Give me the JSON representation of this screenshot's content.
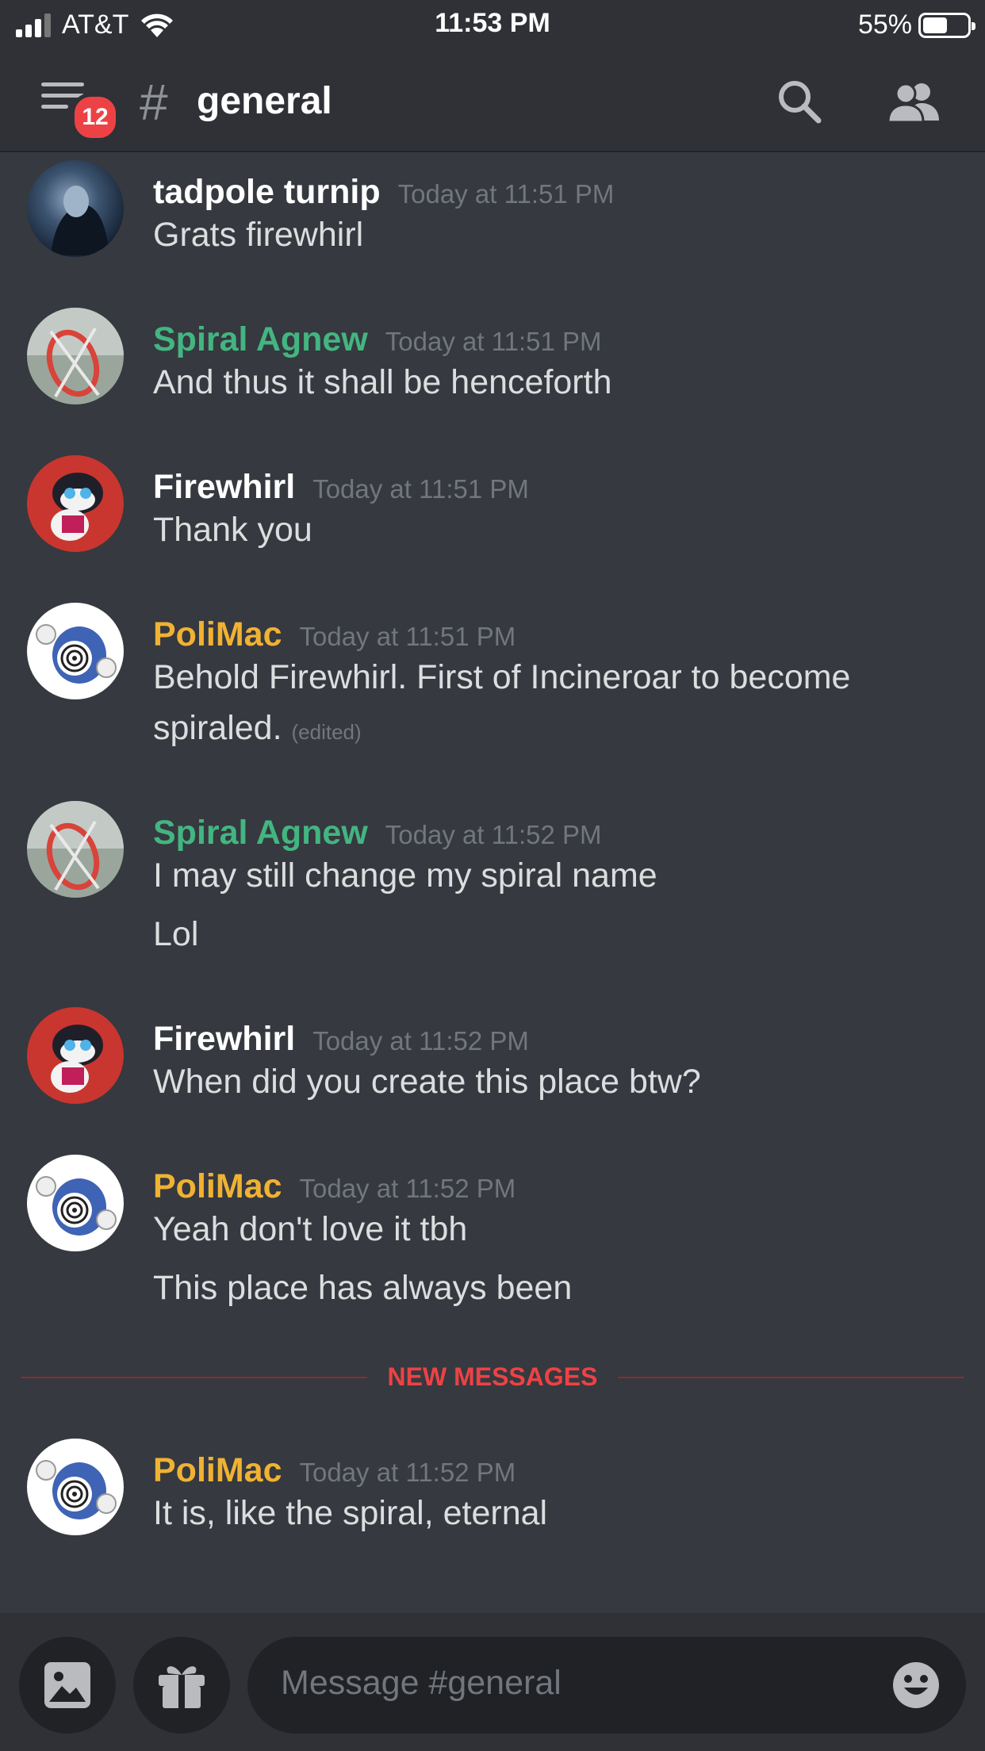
{
  "status": {
    "carrier": "AT&T",
    "time": "11:53 PM",
    "battery": "55%",
    "battery_level": 0.55
  },
  "header": {
    "badge": "12",
    "hash": "#",
    "channel": "general",
    "icons": [
      "menu-icon",
      "search-icon",
      "members-icon"
    ]
  },
  "messages": [
    {
      "author": "tadpole turnip",
      "color": "#ffffff",
      "time": "Today at 11:51 PM",
      "lines": [
        "Grats firewhirl"
      ]
    },
    {
      "author": "Spiral Agnew",
      "color": "#43b581",
      "time": "Today at 11:51 PM",
      "lines": [
        "And thus it shall be henceforth"
      ]
    },
    {
      "author": "Firewhirl",
      "color": "#ffffff",
      "time": "Today at 11:51 PM",
      "lines": [
        "Thank you"
      ]
    },
    {
      "author": "PoliMac",
      "color": "#f0b232",
      "time": "Today at 11:51 PM",
      "lines": [
        "Behold Firewhirl. First of Incineroar to become",
        "spiraled."
      ],
      "edited": "(edited)"
    },
    {
      "author": "Spiral Agnew",
      "color": "#43b581",
      "time": "Today at 11:52 PM",
      "lines": [
        "I may still change my spiral name",
        "Lol"
      ]
    },
    {
      "author": "Firewhirl",
      "color": "#ffffff",
      "time": "Today at 11:52 PM",
      "lines": [
        "When did you create this place btw?"
      ]
    },
    {
      "author": "PoliMac",
      "color": "#f0b232",
      "time": "Today at 11:52 PM",
      "lines": [
        "Yeah don't love it tbh",
        "This place has always been"
      ]
    },
    {
      "author": "PoliMac",
      "color": "#f0b232",
      "time": "Today at 11:52 PM",
      "lines": [
        "It is, like the spiral, eternal"
      ]
    }
  ],
  "divider": {
    "label": "NEW MESSAGES",
    "color": "#ed4245"
  },
  "composer": {
    "placeholder": "Message #general",
    "icons": [
      "image-icon",
      "gift-icon",
      "emoji-icon"
    ]
  },
  "colors": {
    "background": "#36393f",
    "chrome": "#2f3136",
    "input": "#202225",
    "accent_red": "#ed4245"
  }
}
